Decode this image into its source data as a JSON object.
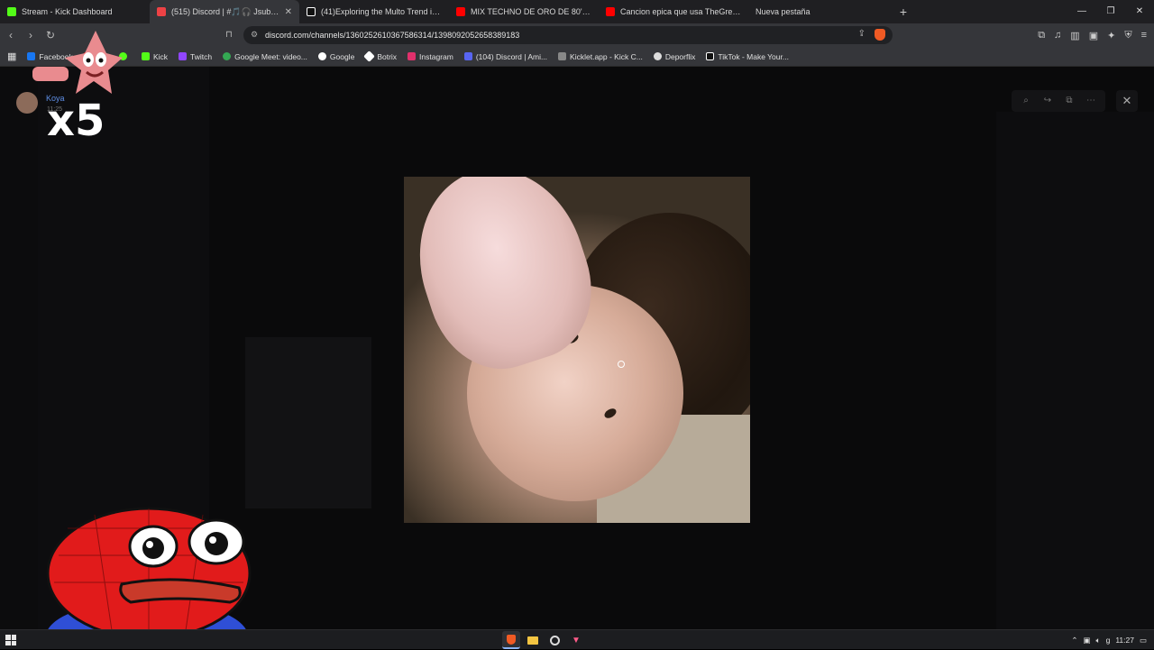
{
  "tabs": [
    {
      "title": "Stream - Kick Dashboard",
      "favicon_color": "#53fc18",
      "active": false
    },
    {
      "title": "(515) Discord | #🎵🎧 Jsubs | SAP...",
      "favicon_color": "#ed4245",
      "active": true
    },
    {
      "title": "(41)Exploring the Multo Trend in Rob...",
      "favicon_color": "#ffffff",
      "active": false
    },
    {
      "title": "MIX TECHNO DE ORO DE 80's & 90's...",
      "favicon_color": "#ff0000",
      "active": false
    },
    {
      "title": "Cancion epica que usa TheGrefg \"Vi...",
      "favicon_color": "#ff0000",
      "active": false
    },
    {
      "title": "Nueva pestaña",
      "favicon_color": "",
      "active": false
    }
  ],
  "url": "discord.com/channels/1360252610367586314/1398092052658389183",
  "bookmarks": [
    {
      "label": "Facebook",
      "color": "#1877f2"
    },
    {
      "label": "ube",
      "color": "#ff0000"
    },
    {
      "label": "",
      "color": "#53fc18"
    },
    {
      "label": "Kick",
      "color": "#53fc18"
    },
    {
      "label": "Twitch",
      "color": "#9146ff"
    },
    {
      "label": "Google Meet: video...",
      "color": "#34a853"
    },
    {
      "label": "Google",
      "color": "#ffffff"
    },
    {
      "label": "Botrix",
      "color": "#ffffff"
    },
    {
      "label": "Instagram",
      "color": "#e1306c"
    },
    {
      "label": "(104) Discord | Ami...",
      "color": "#5865f2"
    },
    {
      "label": "Kicklet.app - Kick C...",
      "color": "#aaaaaa"
    },
    {
      "label": "Deporflix",
      "color": "#ffffff"
    },
    {
      "label": "TikTok - Make Your...",
      "color": "#ffffff"
    }
  ],
  "overlay": {
    "user": "Koya",
    "time": "11:25",
    "multiplier": "x5"
  },
  "taskbar": {
    "clock": "11:27"
  },
  "icons": {
    "zoom": "zoom-icon",
    "forward": "forward-icon",
    "open": "open-external-icon",
    "more": "more-icon",
    "close": "close-icon"
  }
}
